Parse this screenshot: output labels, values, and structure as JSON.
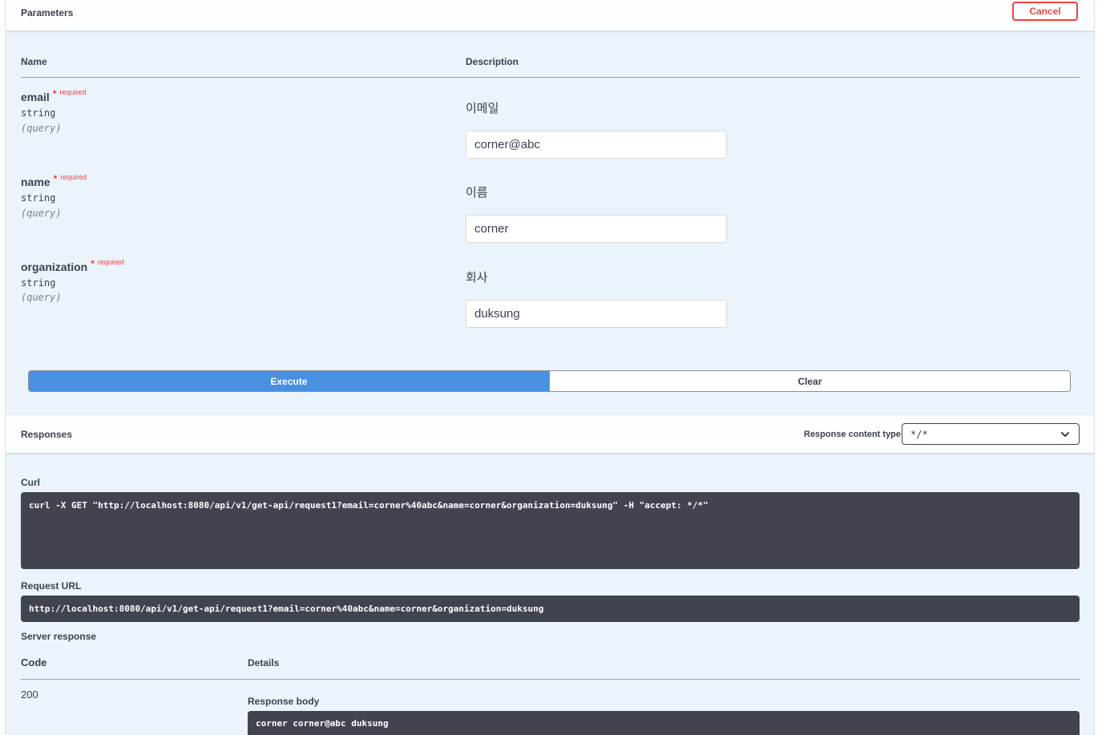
{
  "parameters": {
    "title": "Parameters",
    "cancel_label": "Cancel",
    "col_name": "Name",
    "col_description": "Description",
    "items": [
      {
        "name": "email",
        "star": "*",
        "required": "required",
        "type": "string",
        "in": "(query)",
        "description": "이메일",
        "value": "corner@abc"
      },
      {
        "name": "name",
        "star": "*",
        "required": "required",
        "type": "string",
        "in": "(query)",
        "description": "이름",
        "value": "corner"
      },
      {
        "name": "organization",
        "star": "*",
        "required": "required",
        "type": "string",
        "in": "(query)",
        "description": "회사",
        "value": "duksung"
      }
    ]
  },
  "actions": {
    "execute_label": "Execute",
    "clear_label": "Clear"
  },
  "responses": {
    "title": "Responses",
    "content_type_label": "Response content type",
    "content_type_value": "*/*",
    "curl_label": "Curl",
    "curl_command": "curl -X GET \"http://localhost:8080/api/v1/get-api/request1?email=corner%40abc&name=corner&organization=duksung\" -H \"accept: */*\"",
    "request_url_label": "Request URL",
    "request_url": "http://localhost:8080/api/v1/get-api/request1?email=corner%40abc&name=corner&organization=duksung",
    "server_response_label": "Server response",
    "col_code": "Code",
    "col_details": "Details",
    "code": "200",
    "response_body_label": "Response body",
    "response_body": "corner corner@abc duksung"
  },
  "colors": {
    "panel_bg": "#ebf3fb",
    "execute_blue": "#4990e2",
    "danger_red": "#f93e3e",
    "code_bg": "#41444e"
  }
}
